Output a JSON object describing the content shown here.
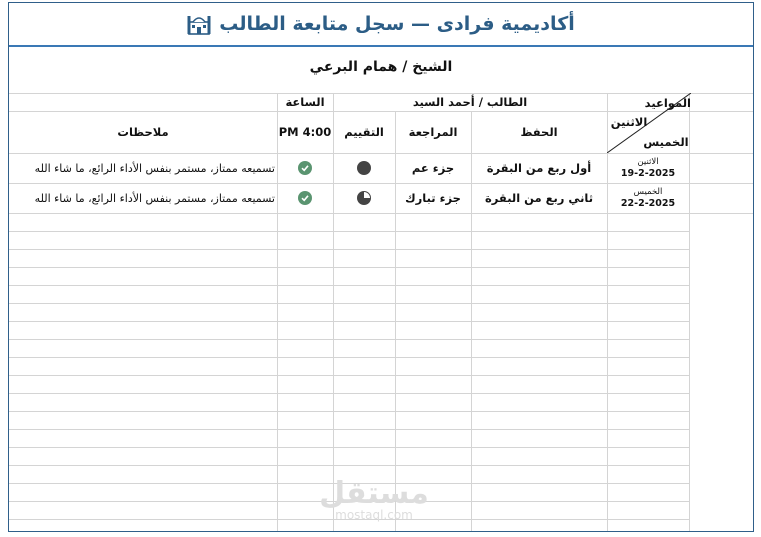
{
  "title": "أكاديمية فرادى — سجل متابعة الطالب",
  "sheikh": "الشيخ / همام البرعي",
  "header": {
    "student": "الطالب / أحمد السيد",
    "hour_label": "الساعة",
    "hour_value": "4:00 PM",
    "schedule_label": "المواعيد",
    "day_monday": "الاثنين",
    "day_thursday": "الخميس",
    "memorization": "الحفظ",
    "review": "المراجعة",
    "rating": "التقييم",
    "notes": "ملاحظات"
  },
  "rows": [
    {
      "day": "الاثنين",
      "date": "19-2-2025",
      "memorization": "أول ربع من البقرة",
      "review": "جزء عم",
      "rating": "full",
      "status": "check",
      "notes": "تسميعه ممتاز، مستمر بنفس الأداء الرائع، ما شاء الله"
    },
    {
      "day": "الخميس",
      "date": "22-2-2025",
      "memorization": "ثاني ربع من البقرة",
      "review": "جزء تبارك",
      "rating": "three-quarter",
      "status": "check",
      "notes": "تسميعه ممتاز، مستمر بنفس الأداء الرائع، ما شاء الله"
    }
  ],
  "watermark": {
    "arabic": "مستقل",
    "latin": "mostaql.com"
  },
  "colors": {
    "title": "#2c5d86",
    "accent_line": "#3a78b5",
    "check": "#5a9470",
    "grid": "#d4d4d4"
  }
}
